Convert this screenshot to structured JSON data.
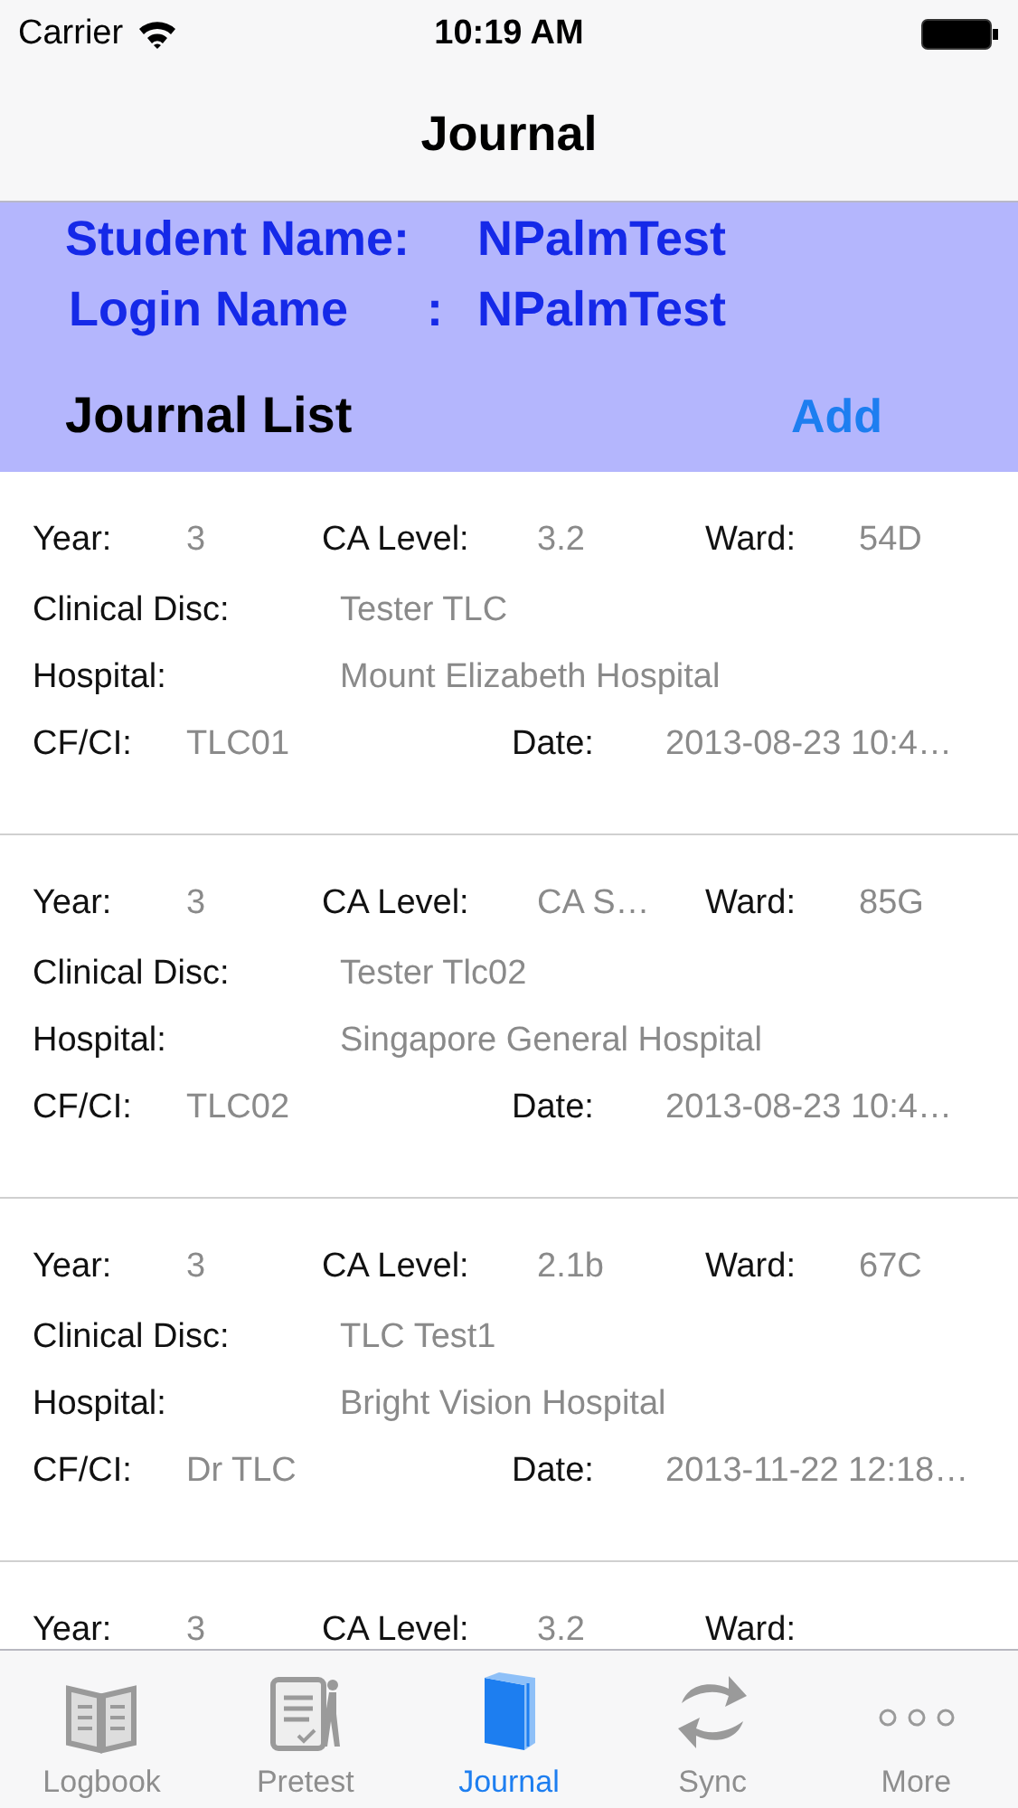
{
  "status_bar": {
    "carrier": "Carrier",
    "time": "10:19 AM"
  },
  "nav_bar": {
    "title": "Journal"
  },
  "header": {
    "student": {
      "label": "Student Name:",
      "value": "NPalmTest"
    },
    "login": {
      "label": "Login Name",
      "separator": ":",
      "value": "NPalmTest"
    },
    "list_title": "Journal List",
    "add_button": "Add"
  },
  "entries": [
    {
      "year": {
        "label": "Year:",
        "value": "3"
      },
      "ca_level": {
        "label": "CA Level:",
        "value": "3.2"
      },
      "ward": {
        "label": "Ward:",
        "value": "54D"
      },
      "clinical_disc": {
        "label": "Clinical Disc:",
        "value": "Tester TLC"
      },
      "hospital": {
        "label": "Hospital:",
        "value": "Mount Elizabeth Hospital"
      },
      "cf_ci": {
        "label": "CF/CI:",
        "value": "TLC01"
      },
      "date": {
        "label": "Date:",
        "value": "2013-08-23 10:4…"
      }
    },
    {
      "year": {
        "label": "Year:",
        "value": "3"
      },
      "ca_level": {
        "label": "CA Level:",
        "value": "CA S…"
      },
      "ward": {
        "label": "Ward:",
        "value": "85G"
      },
      "clinical_disc": {
        "label": "Clinical Disc:",
        "value": "Tester Tlc02"
      },
      "hospital": {
        "label": "Hospital:",
        "value": "Singapore General Hospital"
      },
      "cf_ci": {
        "label": "CF/CI:",
        "value": "TLC02"
      },
      "date": {
        "label": "Date:",
        "value": "2013-08-23 10:4…"
      }
    },
    {
      "year": {
        "label": "Year:",
        "value": "3"
      },
      "ca_level": {
        "label": "CA Level:",
        "value": "2.1b"
      },
      "ward": {
        "label": "Ward:",
        "value": "67C"
      },
      "clinical_disc": {
        "label": "Clinical Disc:",
        "value": "TLC Test1"
      },
      "hospital": {
        "label": "Hospital:",
        "value": "Bright Vision Hospital"
      },
      "cf_ci": {
        "label": "CF/CI:",
        "value": "Dr TLC"
      },
      "date": {
        "label": "Date:",
        "value": "2013-11-22 12:18…"
      }
    },
    {
      "year": {
        "label": "Year:",
        "value": "3"
      },
      "ca_level": {
        "label": "CA Level:",
        "value": "3.2"
      },
      "ward": {
        "label": "Ward:"
      }
    }
  ],
  "tabs": [
    {
      "kind": "logbook",
      "label": "Logbook",
      "selected": false
    },
    {
      "kind": "pretest",
      "label": "Pretest",
      "selected": false
    },
    {
      "kind": "journal",
      "label": "Journal",
      "selected": true
    },
    {
      "kind": "sync",
      "label": "Sync",
      "selected": false
    },
    {
      "kind": "more",
      "label": "More",
      "selected": false
    }
  ]
}
